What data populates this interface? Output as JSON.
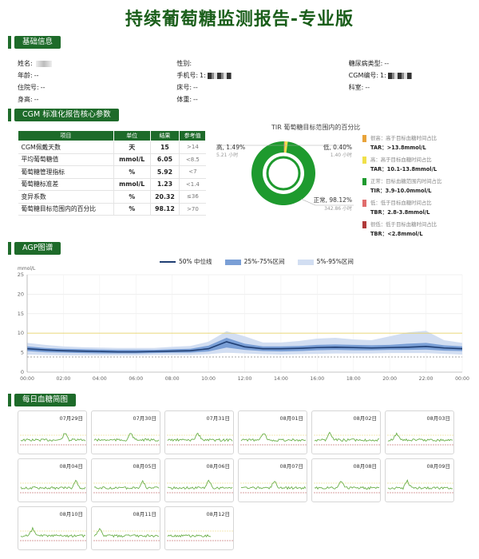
{
  "title": "持续葡萄糖监测报告-专业版",
  "sections": {
    "basic": "基础信息",
    "core": "CGM 标准化报告核心参数",
    "agp": "AGP图谱",
    "daily": "每日血糖简图"
  },
  "basic_info": {
    "rows": [
      [
        {
          "label": "姓名:",
          "value": "",
          "masked": "light"
        },
        {
          "label": "性别:",
          "value": ""
        },
        {
          "label": "糖尿病类型:",
          "value": "--"
        }
      ],
      [
        {
          "label": "年龄:",
          "value": "--"
        },
        {
          "label": "手机号:",
          "value": "1:",
          "masked": "dark"
        },
        {
          "label": "CGM编号:",
          "value": "1:",
          "masked": "dark"
        }
      ],
      [
        {
          "label": "住院号:",
          "value": "--"
        },
        {
          "label": "床号:",
          "value": "--"
        },
        {
          "label": "科室:",
          "value": "--"
        }
      ],
      [
        {
          "label": "身高:",
          "value": "--"
        },
        {
          "label": "体重:",
          "value": "--"
        },
        {
          "label": "",
          "value": ""
        }
      ]
    ]
  },
  "core_table": {
    "headers": [
      "项目",
      "单位",
      "结果",
      "参考值"
    ],
    "rows": [
      [
        "CGM佩戴天数",
        "天",
        "15",
        ">14"
      ],
      [
        "平均葡萄糖值",
        "mmol/L",
        "6.05",
        "<8.5"
      ],
      [
        "葡萄糖管理指标",
        "%",
        "5.92",
        "<7"
      ],
      [
        "葡萄糖标准差",
        "mmol/L",
        "1.23",
        "<1.4"
      ],
      [
        "变异系数",
        "%",
        "20.32",
        "≤36"
      ],
      [
        "葡萄糖目标范围内的百分比",
        "%",
        "98.12",
        ">70"
      ]
    ]
  },
  "tir": {
    "title": "TIR 葡萄糖目标范围内的百分比",
    "high_label": "高, 1.49%",
    "high_sub": "5.21 小时",
    "low_label": "低, 0.40%",
    "low_sub": "1.40 小时",
    "normal_label": "正常, 98.12%",
    "normal_sub": "342.86 小时",
    "values": {
      "high": 1.49,
      "low": 0.4,
      "normal": 98.12
    },
    "legend": [
      {
        "color": "#e8a33a",
        "desc": "很高：高于目标血糖时间占比",
        "value": "TAR：>13.8mmol/L"
      },
      {
        "color": "#f0e04a",
        "desc": "高：高于目标血糖时间占比",
        "value": "TAR：10.1-13.8mmol/L"
      },
      {
        "color": "#1e9a2e",
        "desc": "正常：目标血糖范围内时间占比",
        "value": "TIR：3.9-10.0mmol/L"
      },
      {
        "color": "#e06c6c",
        "desc": "低：低于目标血糖时间占比",
        "value": "TBR：2.8-3.8mmol/L"
      },
      {
        "color": "#b03a3a",
        "desc": "很低：低于目标血糖时间占比",
        "value": "TBR：<2.8mmol/L"
      }
    ]
  },
  "agp": {
    "legend": [
      "50% 中位线",
      "25%-75%区间",
      "5%-95%区间"
    ],
    "colors": {
      "median": "#1f3e73",
      "iqr": "#7a9fd6",
      "outer": "#d2def2",
      "target": "#e8d36a",
      "low": "#888888"
    },
    "ylabel": "mmol/L",
    "yticks": [
      "0",
      "5",
      "10",
      "15",
      "20",
      "25"
    ],
    "xticks": [
      "00:00",
      "02:00",
      "04:00",
      "06:00",
      "08:00",
      "10:00",
      "12:00",
      "14:00",
      "16:00",
      "18:00",
      "20:00",
      "22:00",
      "00:00"
    ]
  },
  "chart_data": {
    "type": "area",
    "ylabel": "mmol/L",
    "ylim": [
      0,
      25
    ],
    "x": [
      "00:00",
      "01:00",
      "02:00",
      "03:00",
      "04:00",
      "05:00",
      "06:00",
      "07:00",
      "08:00",
      "09:00",
      "10:00",
      "11:00",
      "12:00",
      "13:00",
      "14:00",
      "15:00",
      "16:00",
      "17:00",
      "18:00",
      "19:00",
      "20:00",
      "21:00",
      "22:00",
      "23:00",
      "24:00"
    ],
    "series": [
      {
        "name": "50% 中位线",
        "values": [
          6.0,
          5.7,
          5.5,
          5.4,
          5.3,
          5.2,
          5.2,
          5.3,
          5.4,
          5.5,
          6.0,
          7.8,
          6.5,
          6.0,
          6.0,
          6.1,
          6.3,
          6.4,
          6.3,
          6.2,
          6.3,
          6.4,
          6.6,
          6.2,
          6.0
        ]
      },
      {
        "name": "25%",
        "values": [
          5.4,
          5.1,
          5.0,
          4.9,
          4.8,
          4.8,
          4.8,
          4.9,
          5.0,
          5.0,
          5.3,
          6.3,
          5.7,
          5.4,
          5.3,
          5.4,
          5.6,
          5.7,
          5.6,
          5.6,
          5.7,
          5.7,
          5.8,
          5.5,
          5.4
        ]
      },
      {
        "name": "75%",
        "values": [
          6.6,
          6.2,
          6.0,
          5.9,
          5.8,
          5.7,
          5.7,
          5.7,
          5.9,
          6.0,
          6.8,
          8.8,
          7.3,
          6.6,
          6.6,
          6.7,
          7.0,
          7.1,
          7.0,
          6.9,
          7.0,
          7.3,
          7.5,
          6.9,
          6.6
        ]
      },
      {
        "name": "5%",
        "values": [
          4.5,
          4.4,
          4.3,
          4.3,
          4.3,
          4.3,
          4.3,
          4.4,
          4.4,
          4.4,
          4.6,
          5.0,
          4.8,
          4.6,
          4.5,
          4.6,
          4.7,
          4.8,
          4.8,
          4.8,
          4.9,
          4.9,
          4.9,
          4.7,
          4.5
        ]
      },
      {
        "name": "95%",
        "values": [
          7.5,
          7.0,
          6.6,
          6.4,
          6.3,
          6.2,
          6.2,
          6.2,
          6.5,
          6.7,
          7.8,
          10.5,
          9.2,
          7.6,
          7.6,
          8.0,
          8.6,
          8.8,
          8.4,
          8.2,
          9.2,
          10.2,
          10.6,
          8.2,
          7.5
        ]
      }
    ]
  },
  "daily_dates": [
    "07月29日",
    "07月30日",
    "07月31日",
    "08月01日",
    "08月02日",
    "08月03日",
    "08月04日",
    "08月05日",
    "08月06日",
    "08月07日",
    "08月08日",
    "08月09日",
    "08月10日",
    "08月11日",
    "08月12日"
  ]
}
